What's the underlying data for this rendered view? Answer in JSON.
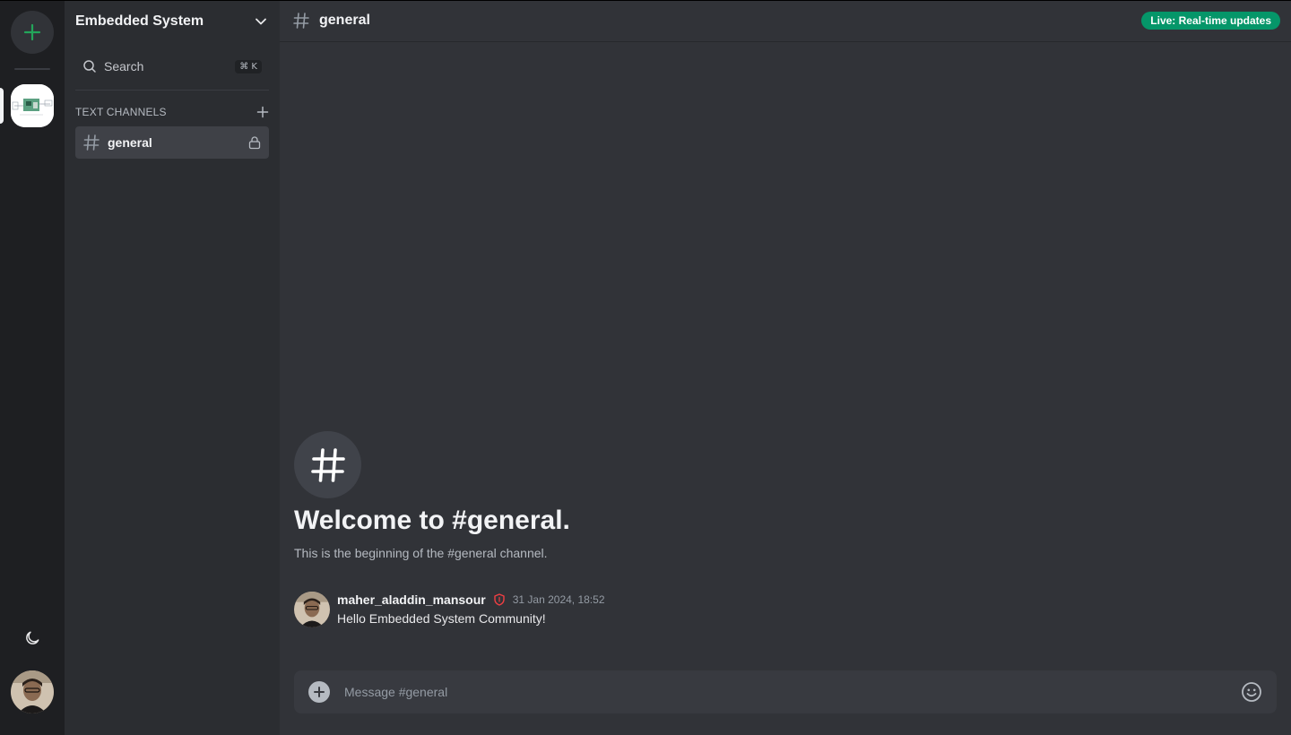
{
  "rail": {
    "add_server_icon": "plus-icon",
    "theme_icon": "moon-icon",
    "accent": "#23a55a"
  },
  "sidebar": {
    "server_name": "Embedded System",
    "search": {
      "label": "Search",
      "shortcut": "⌘ K"
    },
    "section_title": "TEXT CHANNELS",
    "channels": [
      {
        "name": "general",
        "active": true,
        "locked": true
      }
    ]
  },
  "header": {
    "channel": "general",
    "live_badge": "Live: Real-time updates",
    "live_color": "#059669"
  },
  "welcome": {
    "title": "Welcome to #general.",
    "subtitle": "This is the beginning of the #general channel."
  },
  "messages": [
    {
      "author": "maher_aladdin_mansour",
      "timestamp": "31 Jan 2024, 18:52",
      "text": "Hello Embedded System Community!",
      "role_icon": "shield-icon",
      "role_color": "#f23f43"
    }
  ],
  "composer": {
    "placeholder": "Message #general"
  }
}
